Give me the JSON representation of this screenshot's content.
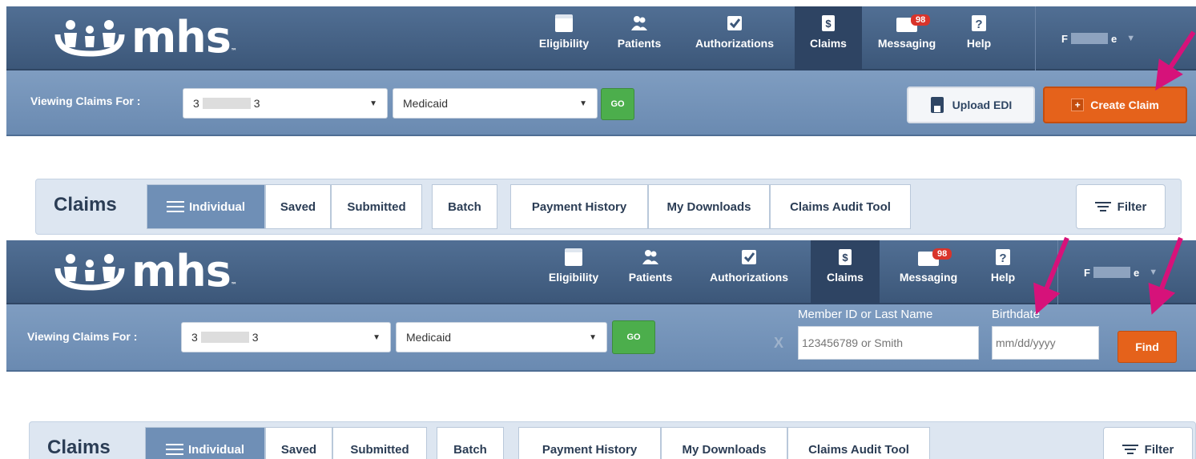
{
  "panel1": {
    "nav": {
      "logo": "mhs",
      "items": [
        {
          "label": "Eligibility",
          "icon": "calendar-icon"
        },
        {
          "label": "Patients",
          "icon": "patients-icon"
        },
        {
          "label": "Authorizations",
          "icon": "checkbox-icon"
        },
        {
          "label": "Claims",
          "icon": "dollar-icon"
        },
        {
          "label": "Messaging",
          "icon": "envelope-icon",
          "badge": "98"
        },
        {
          "label": "Help",
          "icon": "question-icon"
        }
      ],
      "user_initial": "F",
      "user_suffix": "e"
    },
    "subbar": {
      "viewing_label": "Viewing Claims For :",
      "account_prefix": "3",
      "account_suffix": "3",
      "plan": "Medicaid",
      "go": "GO",
      "upload_edi": "Upload EDI",
      "create_claim": "Create Claim"
    },
    "tabs": {
      "title": "Claims",
      "individual": "Individual",
      "saved": "Saved",
      "submitted": "Submitted",
      "batch": "Batch",
      "payment_history": "Payment History",
      "my_downloads": "My Downloads",
      "audit_tool": "Claims Audit Tool",
      "filter": "Filter"
    }
  },
  "panel2": {
    "nav": {
      "logo": "mhs",
      "items": [
        {
          "label": "Eligibility",
          "icon": "calendar-icon"
        },
        {
          "label": "Patients",
          "icon": "patients-icon"
        },
        {
          "label": "Authorizations",
          "icon": "checkbox-icon"
        },
        {
          "label": "Claims",
          "icon": "dollar-icon"
        },
        {
          "label": "Messaging",
          "icon": "envelope-icon",
          "badge": "98"
        },
        {
          "label": "Help",
          "icon": "question-icon"
        }
      ],
      "user_initial": "F",
      "user_suffix": "e"
    },
    "subbar": {
      "viewing_label": "Viewing Claims For :",
      "account_prefix": "3",
      "account_suffix": "3",
      "plan": "Medicaid",
      "go": "GO",
      "clear": "X",
      "member_label": "Member ID or Last Name",
      "member_placeholder": "123456789 or Smith",
      "birthdate_label": "Birthdate",
      "birthdate_placeholder": "mm/dd/yyyy",
      "find": "Find"
    },
    "tabs": {
      "title": "Claims",
      "individual": "Individual",
      "saved": "Saved",
      "submitted": "Submitted",
      "batch": "Batch",
      "payment_history": "Payment History",
      "my_downloads": "My Downloads",
      "audit_tool": "Claims Audit Tool",
      "filter": "Filter"
    }
  },
  "colors": {
    "nav_bg": "#3c5779",
    "subbar_bg": "#7596bc",
    "go_green": "#4cae4c",
    "orange": "#e5621b",
    "arrow_magenta": "#d6127a",
    "badge_red": "#d9342b"
  }
}
